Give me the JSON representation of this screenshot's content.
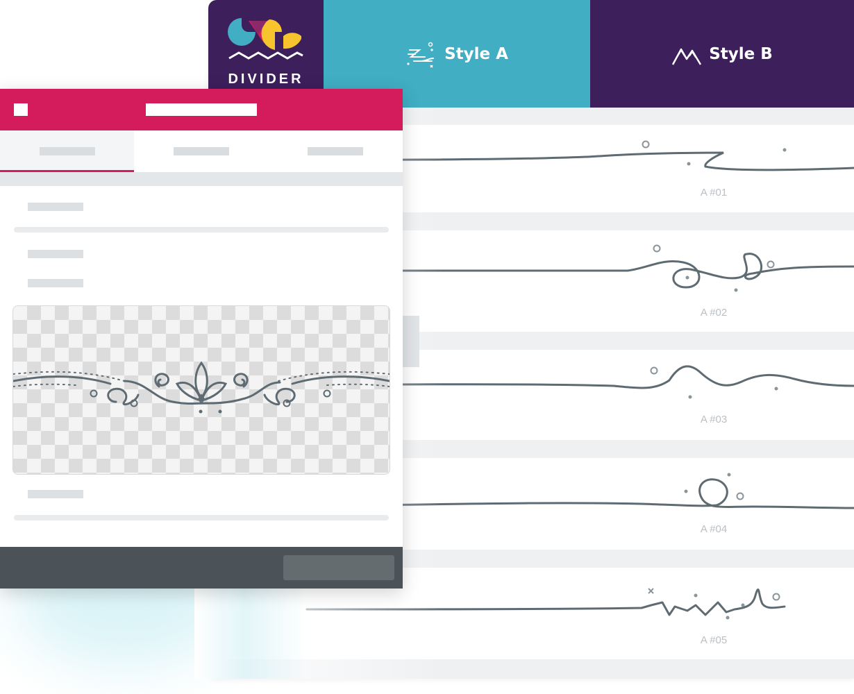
{
  "app": {
    "logo_text": "DIVIDER"
  },
  "tabs": [
    {
      "label": "Style A",
      "icon": "comet-swirl-icon",
      "color": "#41aec3"
    },
    {
      "label": "Style B",
      "icon": "mountain-peaks-icon",
      "color": "#3d1f5c"
    }
  ],
  "dividers": [
    {
      "label": "A #01"
    },
    {
      "label": "A #02"
    },
    {
      "label": "A #03"
    },
    {
      "label": "A #04"
    },
    {
      "label": "A #05"
    }
  ],
  "colors": {
    "brand_purple": "#3d1f5c",
    "brand_teal": "#41aec3",
    "editor_header": "#d41b5c",
    "editor_footer": "#4b5258",
    "stroke": "#5f6b73"
  },
  "editor": {
    "preview_icon": "ornamental-flourish-divider"
  }
}
